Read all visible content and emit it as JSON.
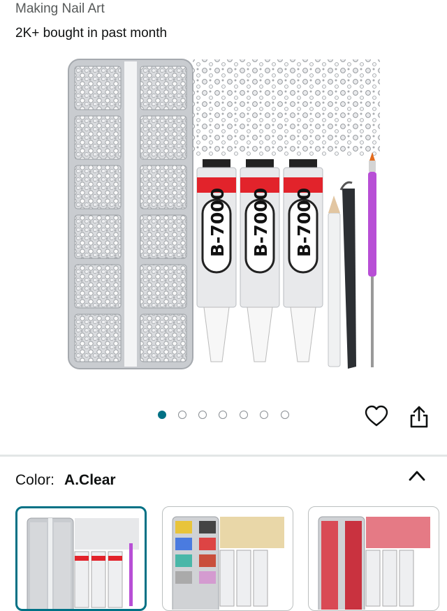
{
  "header": {
    "title": "Making Nail Art",
    "bought": "2K+ bought in past month"
  },
  "gallery": {
    "image_alt": "Nail rhinestones kit with B-7000 glue, tweezers, pencil and dotting pen",
    "glue_label": "B-7000",
    "dots_total": 7,
    "active_index": 0,
    "colors": {
      "active_dot": "#007185",
      "inactive_dot": "#8a8f94"
    }
  },
  "actions": {
    "favorite_icon": "heart-icon",
    "share_icon": "share-icon"
  },
  "variant": {
    "label": "Color:",
    "selected": "A.Clear",
    "toggle_icon": "chevron-up-icon",
    "swatches": [
      {
        "name": "A.Clear",
        "selected": true
      },
      {
        "name": "Multicolor",
        "selected": false
      },
      {
        "name": "Red",
        "selected": false
      }
    ]
  }
}
